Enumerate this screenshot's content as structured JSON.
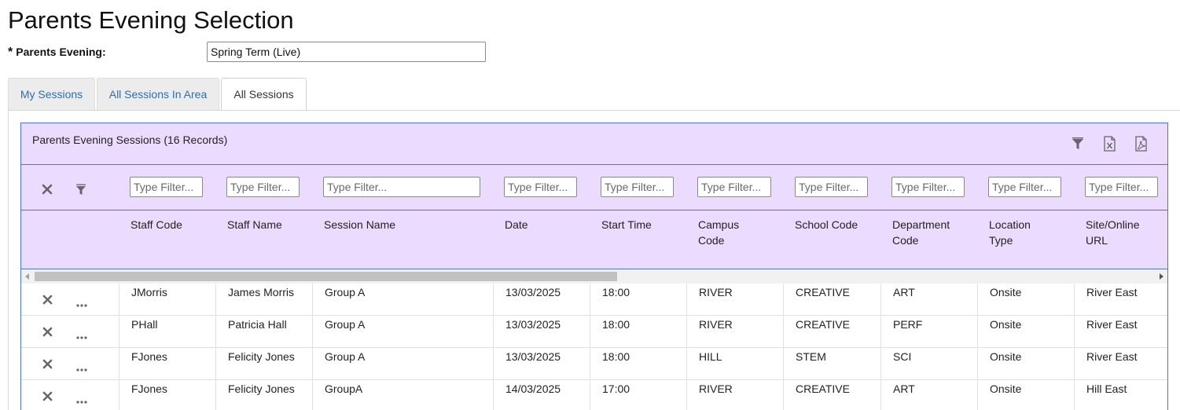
{
  "page": {
    "title": "Parents Evening Selection",
    "parents_evening_label": "Parents Evening:",
    "required_mark": "*",
    "parents_evening_value": "Spring Term (Live)"
  },
  "tabs": [
    {
      "label": "My Sessions",
      "active": false
    },
    {
      "label": "All Sessions In Area",
      "active": false
    },
    {
      "label": "All Sessions",
      "active": true
    }
  ],
  "panel": {
    "title": "Parents Evening Sessions (16 Records)",
    "icons": [
      "filter-icon",
      "excel-export-icon",
      "pdf-export-icon"
    ]
  },
  "filters": {
    "placeholder": "Type Filter..."
  },
  "columns": [
    {
      "label": "Staff Code"
    },
    {
      "label": "Staff Name"
    },
    {
      "label": "Session Name"
    },
    {
      "label": "Date"
    },
    {
      "label": "Start Time"
    },
    {
      "label": "Campus Code"
    },
    {
      "label": "School Code"
    },
    {
      "label": "Department Code"
    },
    {
      "label": "Location Type"
    },
    {
      "label": "Site/Online URL"
    }
  ],
  "rows": [
    [
      "JMorris",
      "James Morris",
      "Group A",
      "13/03/2025",
      "18:00",
      "RIVER",
      "CREATIVE",
      "ART",
      "Onsite",
      "River East"
    ],
    [
      "PHall",
      "Patricia Hall",
      "Group A",
      "13/03/2025",
      "18:00",
      "RIVER",
      "CREATIVE",
      "PERF",
      "Onsite",
      "River East"
    ],
    [
      "FJones",
      "Felicity Jones",
      "Group A",
      "13/03/2025",
      "18:00",
      "HILL",
      "STEM",
      "SCI",
      "Onsite",
      "River East"
    ],
    [
      "FJones",
      "Felicity Jones",
      "GroupA",
      "14/03/2025",
      "17:00",
      "RIVER",
      "CREATIVE",
      "ART",
      "Onsite",
      "Hill East"
    ]
  ],
  "colors": {
    "header_bg": "#ebdcff",
    "panel_border": "#4f73c8",
    "tab_link": "#2f6faf"
  }
}
